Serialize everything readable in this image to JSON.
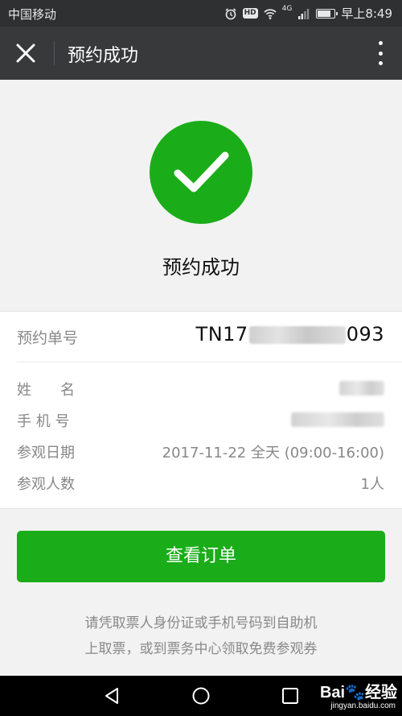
{
  "status_bar": {
    "carrier": "中国移动",
    "network": "4G",
    "hd": "HD",
    "time": "早上8:49",
    "battery_level": 0.85
  },
  "nav": {
    "title": "预约成功",
    "close_icon": "close-icon",
    "more_icon": "more-vertical-icon"
  },
  "success": {
    "icon": "check-icon",
    "title": "预约成功",
    "color": "#1aad19"
  },
  "order": {
    "label": "预约单号",
    "value_prefix": "TN17",
    "value_suffix": "093"
  },
  "details": [
    {
      "label": "姓　　名",
      "value": ""
    },
    {
      "label": "手 机 号",
      "value": ""
    },
    {
      "label": "参观日期",
      "value": "2017-11-22 全天 (09:00-16:00)"
    },
    {
      "label": "参观人数",
      "value": "1人"
    }
  ],
  "button": {
    "label": "查看订单"
  },
  "notes": [
    "请凭取票人身份证或手机号码到自助机",
    "上取票，或到票务中心领取免费参观券"
  ],
  "watermark": {
    "brand": "Bai",
    "brand2": "经验",
    "url": "jingyan.baidu.com"
  }
}
